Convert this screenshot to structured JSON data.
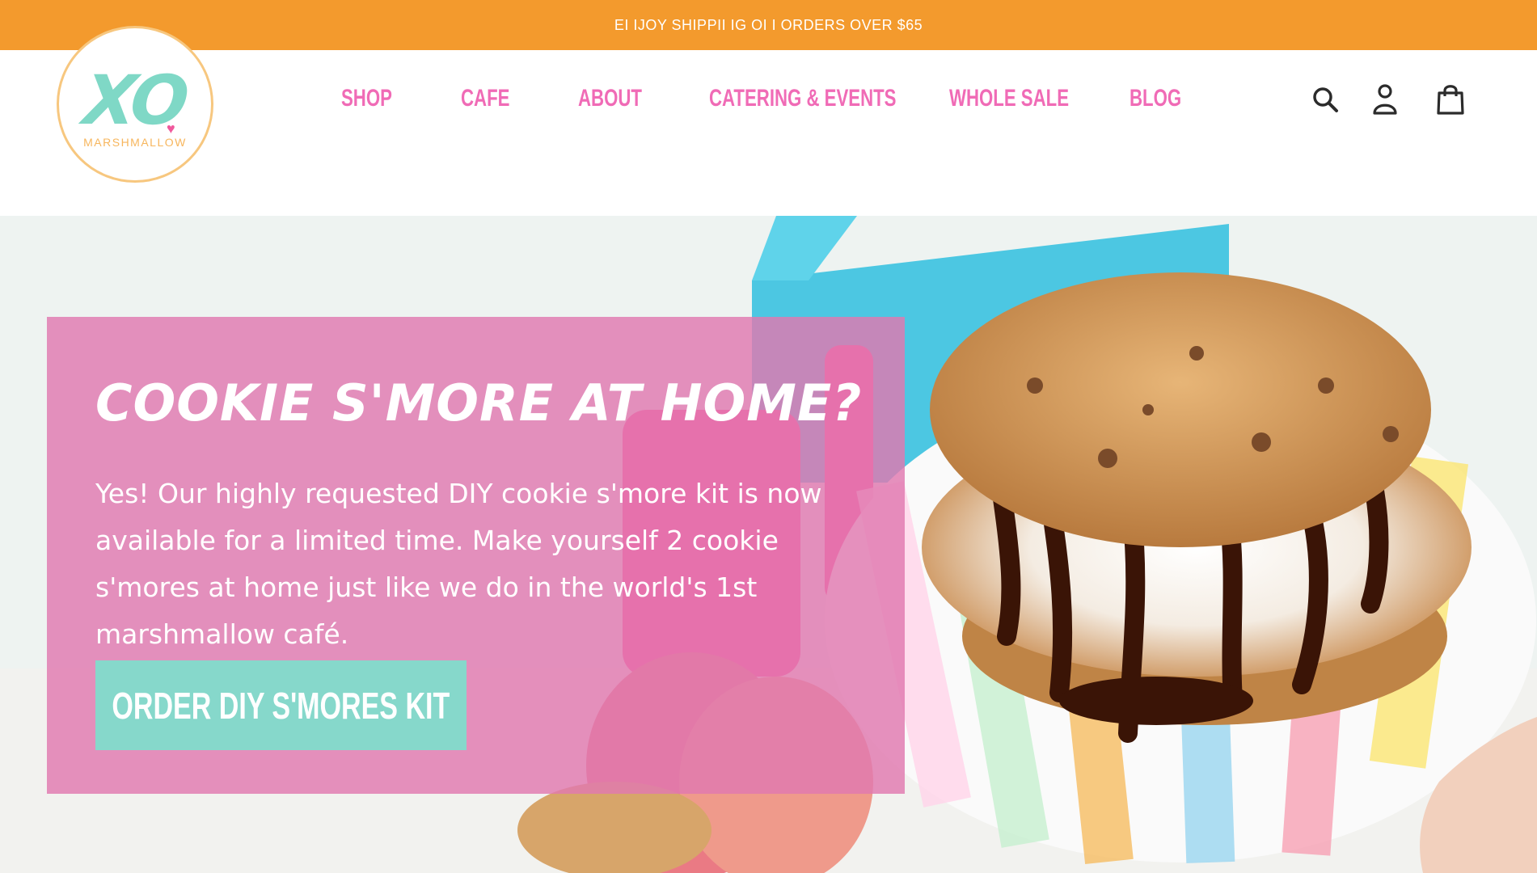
{
  "announcement": {
    "text": "EI IJOY SHIPPII IG OI I ORDERS OVER $65"
  },
  "brand": {
    "logo_mark": "XO",
    "logo_word": "MARSHMALLOW",
    "colors": {
      "orange": "#f39a2d",
      "pink": "#f06bb6",
      "teal": "#86d8cb",
      "promo_overlay": "#e079b0"
    }
  },
  "nav": {
    "items": [
      {
        "label": "SHOP"
      },
      {
        "label": "CAFE"
      },
      {
        "label": "ABOUT"
      },
      {
        "label": "CATERING & EVENTS"
      },
      {
        "label": "WHOLE SALE"
      },
      {
        "label": "BLOG"
      }
    ]
  },
  "header_icons": {
    "search": "search-icon",
    "account": "account-icon",
    "cart": "cart-icon"
  },
  "hero": {
    "title": "COOKIE S'MORE AT HOME?",
    "body": "Yes! Our highly requested DIY cookie s'more kit is now available for a limited time.  Make yourself 2 cookie s'mores at home just like we do in the world's 1st marshmallow café.",
    "cta_label": "ORDER DIY S'MORES KIT"
  }
}
